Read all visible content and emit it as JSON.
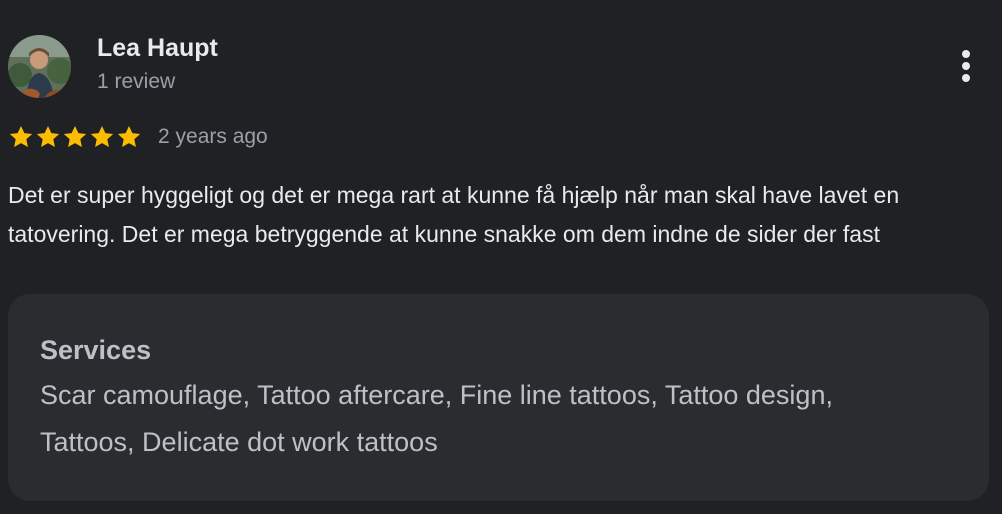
{
  "review": {
    "author": {
      "name": "Lea Haupt",
      "review_count": "1 review",
      "avatar_icon": "user-photo-avatar"
    },
    "rating": {
      "stars": 5,
      "max_stars": 5,
      "star_color": "#fbbc04"
    },
    "date": "2 years ago",
    "text": "Det er super hyggeligt og det er mega rart at kunne få hjælp når man skal have lavet en tatovering. Det er mega betryggende at kunne snakke om dem indne de sider der fast",
    "more_options_icon": "more-vertical-icon",
    "services": {
      "title": "Services",
      "list": "Scar camouflage, Tattoo aftercare, Fine line tattoos, Tattoo design, Tattoos, Delicate dot work tattoos"
    }
  },
  "colors": {
    "background": "#202124",
    "card_background": "#2b2c30",
    "primary_text": "#e8eaed",
    "secondary_text": "#9aa0a6",
    "services_text": "#bdc1c6"
  }
}
